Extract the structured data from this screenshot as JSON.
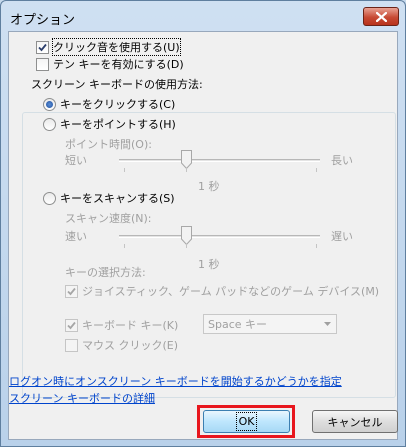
{
  "window": {
    "title": "オプション"
  },
  "options": {
    "click_sound": {
      "label": "クリック音を使用する(U)",
      "checked": true
    },
    "numpad": {
      "label": "テン キーを有効にする(D)",
      "checked": false
    }
  },
  "group": {
    "label": "スクリーン キーボードの使用方法:",
    "click": {
      "label": "キーをクリックする(C)",
      "selected": true
    },
    "hover": {
      "label": "キーをポイントする(H)",
      "time_label": "ポイント時間(O):",
      "short": "短い",
      "long": "長い",
      "value": "1 秒"
    },
    "scan": {
      "label": "キーをスキャンする(S)",
      "speed_label": "スキャン速度(N):",
      "fast": "速い",
      "slow": "遅い",
      "value": "1 秒",
      "select_method_label": "キーの選択方法:",
      "joystick": {
        "label": "ジョイスティック、ゲーム パッドなどのゲーム デバイス(M)",
        "checked": true
      },
      "keyboard_key": {
        "label": "キーボード キー(K)",
        "checked": true,
        "selected_key": "Space キー"
      },
      "mouse_click": {
        "label": "マウス クリック(E)",
        "checked": false
      }
    }
  },
  "links": {
    "logon": "ログオン時にオンスクリーン キーボードを開始するかどうかを指定",
    "details": "スクリーン キーボードの詳細"
  },
  "buttons": {
    "ok": "OK",
    "cancel": "キャンセル"
  }
}
